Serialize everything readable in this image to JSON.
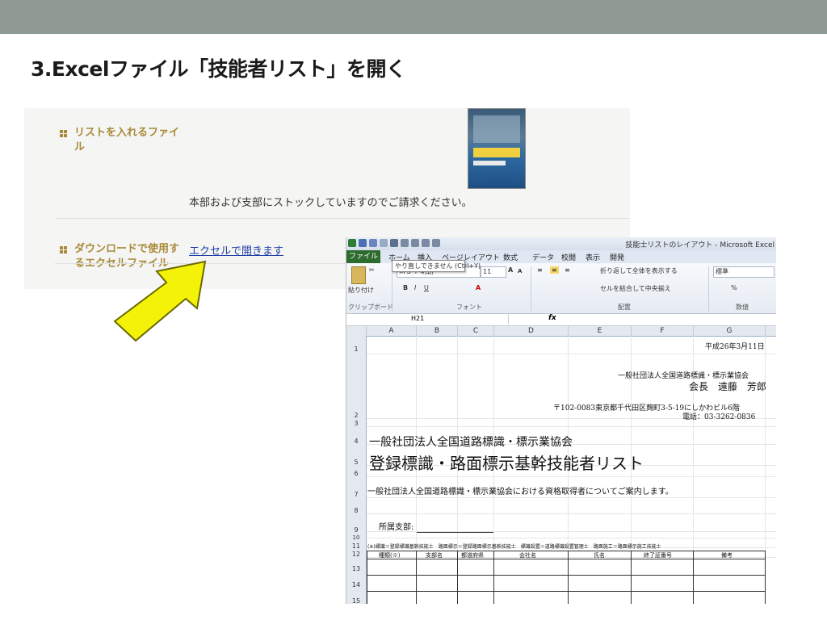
{
  "slide": {
    "title": "3.Excelファイル「技能者リスト」を開く"
  },
  "web": {
    "row1_label": "リストを入れるファイル",
    "row1_text": "本部および支部にストックしていますのでご請求ください。",
    "row2_label": "ダウンロードで使用するエクセルファイル",
    "row2_link": "エクセルで開きます"
  },
  "excel": {
    "window_title": "技能士リストのレイアウト - Microsoft Excel",
    "tabs": [
      "ファイル",
      "ホーム",
      "挿入",
      "ページレイアウト",
      "数式",
      "データ",
      "校閲",
      "表示",
      "開発"
    ],
    "tooltip": "やり直しできません (Ctrl+Y)",
    "font_name": "ＭＳ Ｐ明朝",
    "font_size": "11",
    "wrap_text": "折り返して全体を表示する",
    "merge_center": "セルを結合して中央揃え",
    "number_format": "標準",
    "group_labels": [
      "クリップボード",
      "フォント",
      "配置",
      "数値"
    ],
    "paste_label": "貼り付け",
    "name_box": "H21",
    "fx": "fx",
    "columns": [
      "A",
      "B",
      "C",
      "D",
      "E",
      "F",
      "G"
    ],
    "rows": [
      "1",
      "2",
      "3",
      "4",
      "5",
      "6",
      "7",
      "8",
      "9",
      "10",
      "11",
      "12",
      "13",
      "14",
      "15"
    ],
    "cells": {
      "date": "平成26年3月11日",
      "org_right": "一般社団法人全国道路標識・標示業協会",
      "president": "会長　遠藤　芳郎",
      "address": "〒102-0083東京都千代田区麹町3-5-19にしかわビル6階",
      "phone": "電話：03-3262-0836",
      "org_big": "一般社団法人全国道路標識・標示業協会",
      "list_title": "登録標識・路面標示基幹技能者リスト",
      "intro": "一般社団法人全国道路標識・標示業協会における資格取得者についてご案内します。",
      "branch": "所属支部:",
      "note": "(※)標識＝登録標識基幹技能士　路面標示＝登録路面標示基幹技能士　標識設置＝道路標識設置管理士　路面施工＝路面標示施工技能士",
      "headers": [
        "種類(※)",
        "支部名",
        "都道府県",
        "会社名",
        "氏名",
        "終了証番号",
        "備考"
      ]
    }
  },
  "colors": {
    "topbar": "#8e9a93",
    "label_gold": "#a88a3a",
    "link_blue": "#1f3fa8",
    "arrow_yellow": "#f5f20a",
    "excel_green": "#2e6b2f"
  }
}
